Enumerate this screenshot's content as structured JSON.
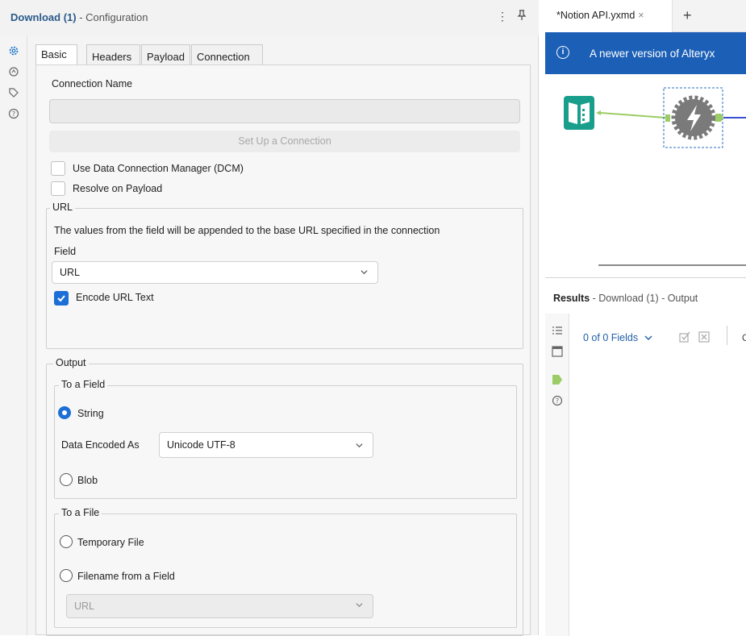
{
  "config": {
    "title_tool": "Download (1)",
    "title_sub": " - Configuration",
    "tabs": [
      "Basic",
      "Headers",
      "Payload",
      "Connection"
    ],
    "connection_name_label": "Connection Name",
    "connection_name_value": "",
    "setup_button": "Set Up a Connection",
    "use_dcm_label": "Use Data Connection Manager (DCM)",
    "resolve_payload_label": "Resolve on Payload",
    "url_group": "URL",
    "url_desc": "The values from the field will be appended to the base URL specified in the connection",
    "field_label": "Field",
    "field_value": "URL",
    "encode_label": "Encode URL Text",
    "output_group": "Output",
    "to_field_group": "To a Field",
    "string_label": "String",
    "encoded_as_label": "Data Encoded As",
    "encoded_as_value": "Unicode UTF-8",
    "blob_label": "Blob",
    "to_file_group": "To a File",
    "temp_file_label": "Temporary File",
    "filename_field_label": "Filename from a Field",
    "filename_field_value": "URL"
  },
  "workflow": {
    "tab_label": "*Notion API.yxmd",
    "tab_close": "×",
    "new_tab": "+",
    "banner_text": "A newer version of Alteryx"
  },
  "results": {
    "title": "Results",
    "subtitle": " - Download (1) - Output",
    "fields_label": "0 of 0 Fields"
  },
  "colors": {
    "accent": "#1b6fd6",
    "banner": "#1b5fb6",
    "input_tool": "#1a9e8c",
    "download_tool": "#7a7a7a",
    "connector": "#9ccc65"
  }
}
